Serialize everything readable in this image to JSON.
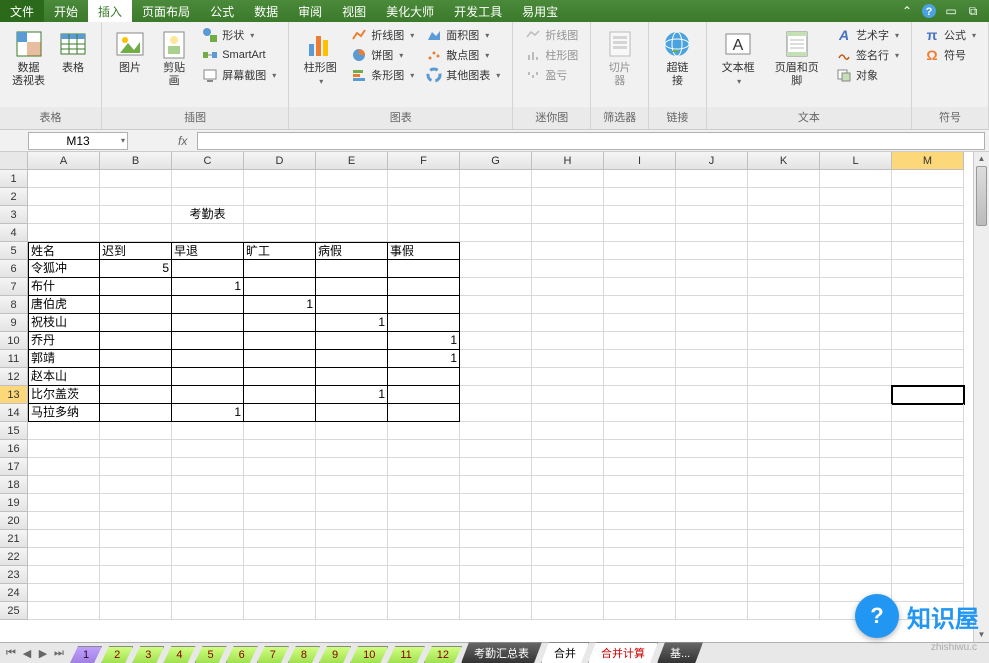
{
  "menu": {
    "file": "文件",
    "tabs": [
      "开始",
      "插入",
      "页面布局",
      "公式",
      "数据",
      "审阅",
      "视图",
      "美化大师",
      "开发工具",
      "易用宝"
    ],
    "active": "插入"
  },
  "ribbon_groups": {
    "tables": {
      "label": "表格",
      "pivot": "数据\n透视表",
      "table": "表格"
    },
    "illustrations": {
      "label": "插图",
      "picture": "图片",
      "clipart": "剪贴画",
      "shapes": "形状",
      "smartart": "SmartArt",
      "screenshot": "屏幕截图"
    },
    "charts": {
      "label": "图表",
      "column": "柱形图",
      "line": "折线图",
      "pie": "饼图",
      "bar": "条形图",
      "area": "面积图",
      "scatter": "散点图",
      "other": "其他图表"
    },
    "sparklines": {
      "label": "迷你图",
      "line": "折线图",
      "column": "柱形图",
      "winloss": "盈亏"
    },
    "filter": {
      "label": "筛选器",
      "slicer": "切片器"
    },
    "links": {
      "label": "链接",
      "hyperlink": "超链接"
    },
    "text": {
      "label": "文本",
      "textbox": "文本框",
      "headerfooter": "页眉和页脚",
      "wordart": "艺术字",
      "signature": "签名行",
      "object": "对象"
    },
    "symbols": {
      "label": "符号",
      "equation": "公式",
      "symbol": "符号"
    }
  },
  "namebox": "M13",
  "fx": "fx",
  "columns": [
    "A",
    "B",
    "C",
    "D",
    "E",
    "F",
    "G",
    "H",
    "I",
    "J",
    "K",
    "L",
    "M"
  ],
  "active_col": "M",
  "active_row": 13,
  "title": "考勤表",
  "headers": [
    "姓名",
    "迟到",
    "早退",
    "旷工",
    "病假",
    "事假"
  ],
  "rows": [
    {
      "name": "令狐冲",
      "vals": [
        "5",
        "",
        "",
        "",
        ""
      ]
    },
    {
      "name": "布什",
      "vals": [
        "",
        "1",
        "",
        "",
        ""
      ]
    },
    {
      "name": "唐伯虎",
      "vals": [
        "",
        "",
        "1",
        "",
        ""
      ]
    },
    {
      "name": "祝枝山",
      "vals": [
        "",
        "",
        "",
        "1",
        ""
      ]
    },
    {
      "name": "乔丹",
      "vals": [
        "",
        "",
        "",
        "",
        "1"
      ]
    },
    {
      "name": "郭靖",
      "vals": [
        "",
        "",
        "",
        "",
        "1"
      ]
    },
    {
      "name": "赵本山",
      "vals": [
        "",
        "",
        "",
        "",
        ""
      ]
    },
    {
      "name": "比尔盖茨",
      "vals": [
        "",
        "",
        "",
        "1",
        ""
      ]
    },
    {
      "name": "马拉多纳",
      "vals": [
        "",
        "1",
        "",
        "",
        ""
      ]
    }
  ],
  "sheets": {
    "nums": [
      "1",
      "2",
      "3",
      "4",
      "5",
      "6",
      "7",
      "8",
      "9",
      "10",
      "11",
      "12"
    ],
    "summary": "考勤汇总表",
    "merge": "合并",
    "merge_calc": "合并计算",
    "base": "基..."
  },
  "badge": "知识屋",
  "badge_sub": "zhishiwu.c"
}
